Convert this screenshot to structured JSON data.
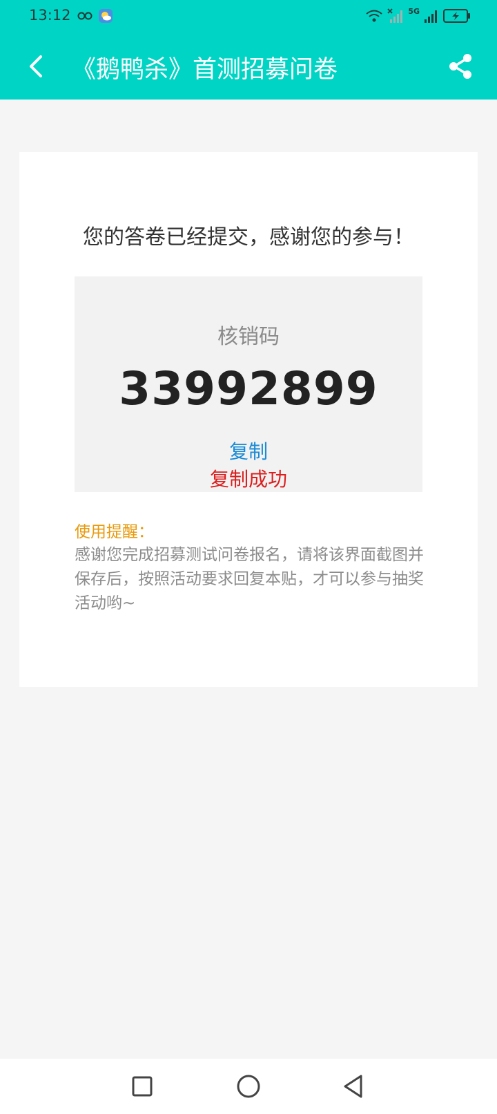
{
  "status_bar": {
    "time": "13:12",
    "network": "5G"
  },
  "header": {
    "title": "《鹅鸭杀》首测招募问卷",
    "back_icon": "chevron-left-icon",
    "share_icon": "share-icon",
    "bg_color": "#00d4c4"
  },
  "main": {
    "thanks_message": "您的答卷已经提交，感谢您的参与！",
    "code_label": "核销码",
    "code_value": "33992899",
    "copy_label": "复制",
    "copy_success": "复制成功",
    "reminder_title": "使用提醒：",
    "reminder_text": "感谢您完成招募测试问卷报名，请将该界面截图并保存后，按照活动要求回复本贴，才可以参与抽奖活动哟~"
  },
  "system_nav": {
    "recents_icon": "square-icon",
    "home_icon": "circle-icon",
    "back_icon": "triangle-back-icon"
  }
}
